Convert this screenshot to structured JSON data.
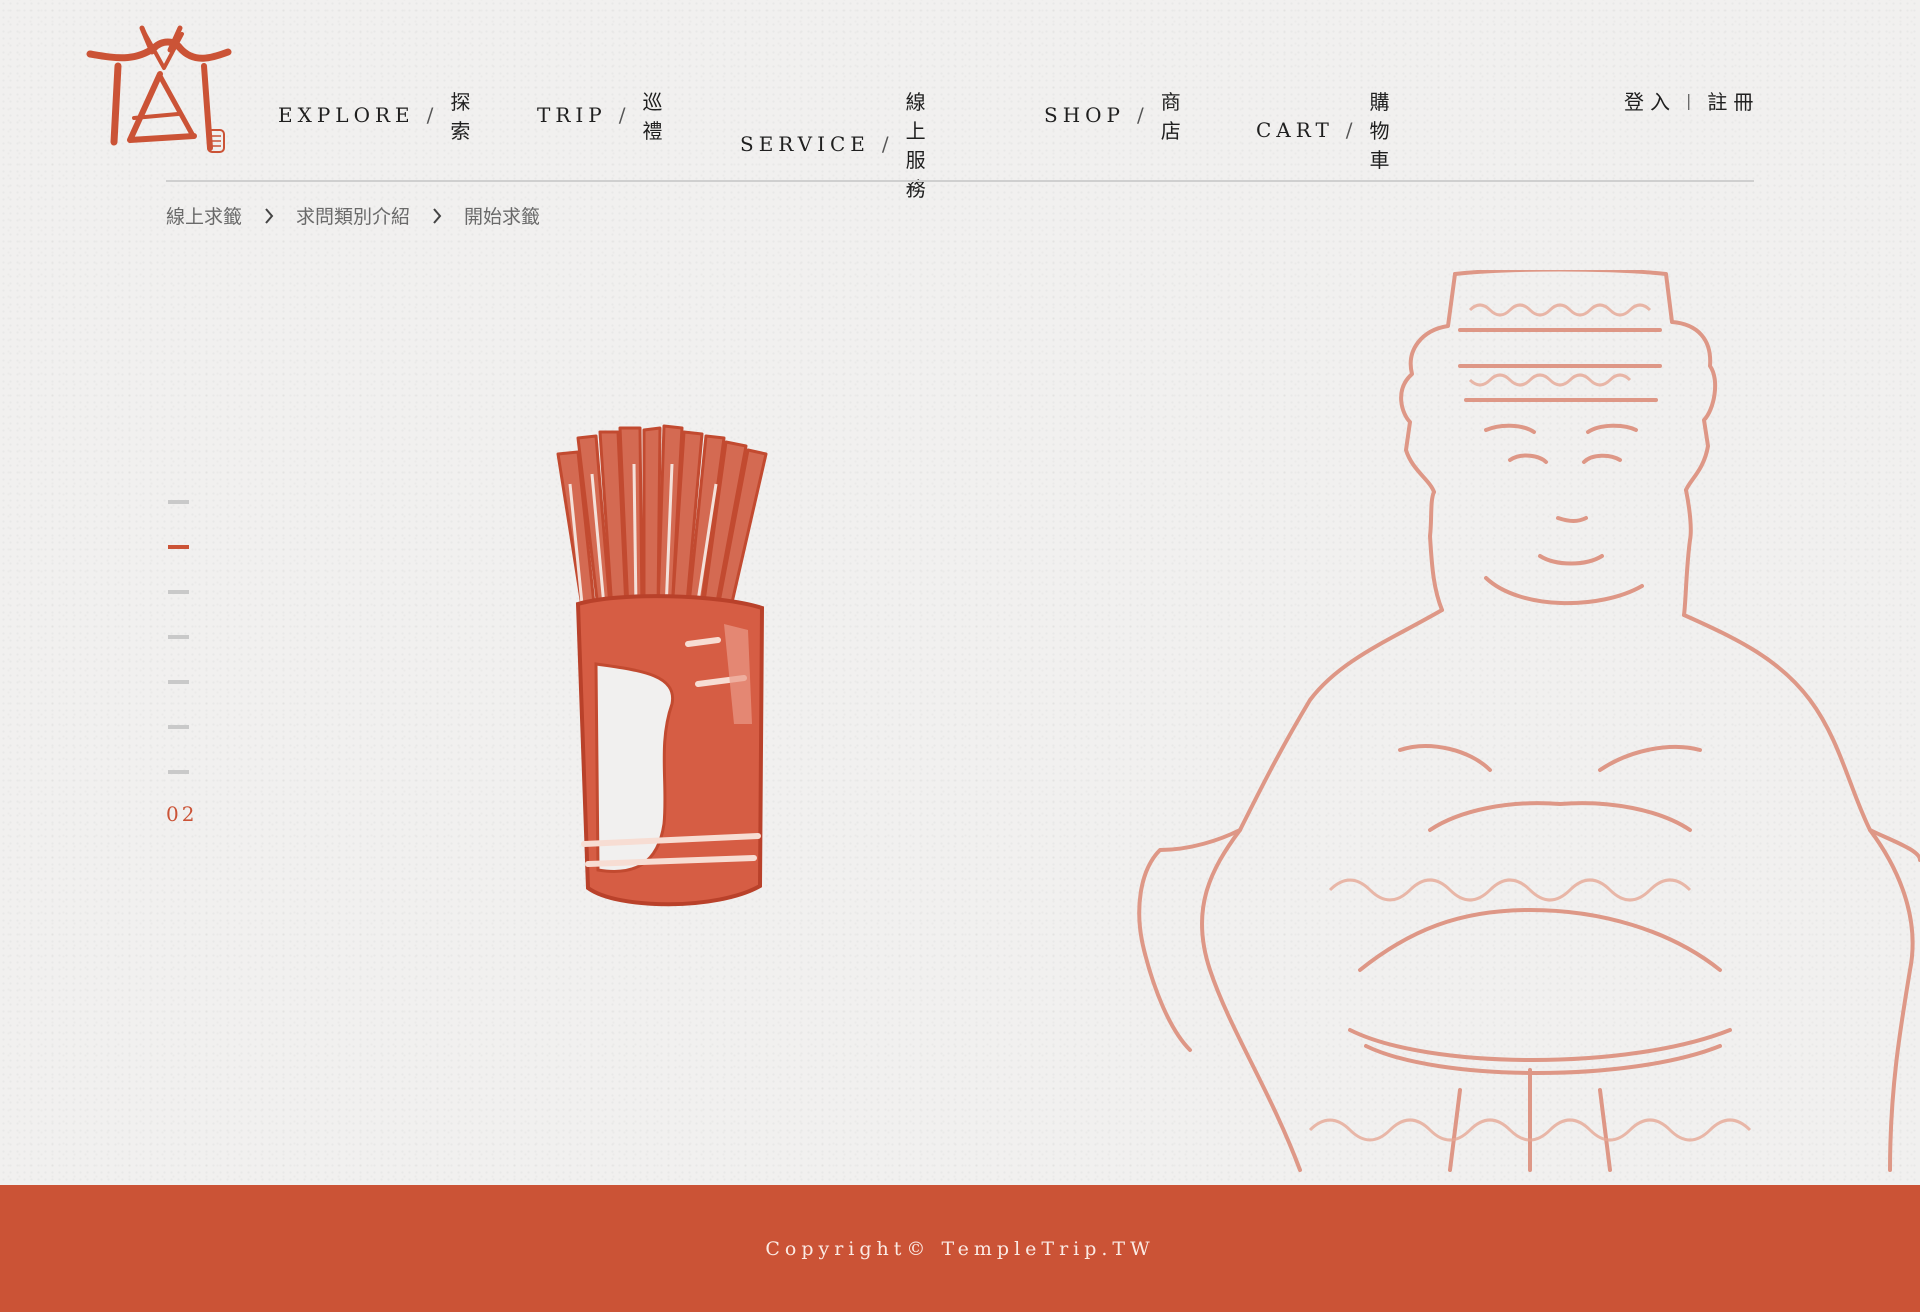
{
  "header": {
    "logo_icon": "temple-logo-icon",
    "nav": [
      {
        "en": "EXPLORE",
        "sep": "/",
        "zh": "探索"
      },
      {
        "en": "TRIP",
        "sep": "/",
        "zh": "巡禮"
      },
      {
        "en": "SERVICE",
        "sep": "/",
        "zh": "線上服務"
      },
      {
        "en": "SHOP",
        "sep": "/",
        "zh": "商店"
      },
      {
        "en": "CART",
        "sep": "/",
        "zh": "購物車"
      }
    ],
    "auth": {
      "login": "登入",
      "divider": "|",
      "register": "註冊"
    }
  },
  "breadcrumb": [
    "線上求籤",
    "求問類別介紹",
    "開始求籤"
  ],
  "pager": {
    "total": 7,
    "active_index": 1,
    "current_label": "02"
  },
  "illustrations": {
    "left": "fortune-sticks-jar-icon",
    "right": "mazu-goddess-sketch-icon"
  },
  "footer": {
    "copyright": "Copyright© TempleTrip.TW"
  },
  "colors": {
    "accent": "#cb5336",
    "background": "#f1f0ef",
    "footer_text": "#fbeae4"
  }
}
